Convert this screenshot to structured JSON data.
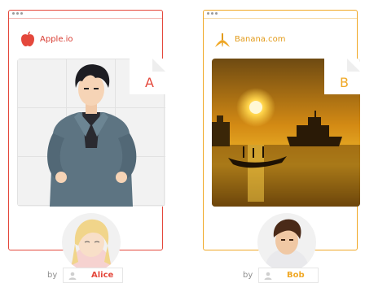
{
  "colors": {
    "apple_accent": "#e4483c",
    "banana_accent": "#f0a826"
  },
  "cards": [
    {
      "site": "Apple.io",
      "badge": "A",
      "logo_icon": "apple-icon",
      "author": "Alice",
      "by_label": "by"
    },
    {
      "site": "Banana.com",
      "badge": "B",
      "logo_icon": "banana-icon",
      "author": "Bob",
      "by_label": "by"
    }
  ]
}
